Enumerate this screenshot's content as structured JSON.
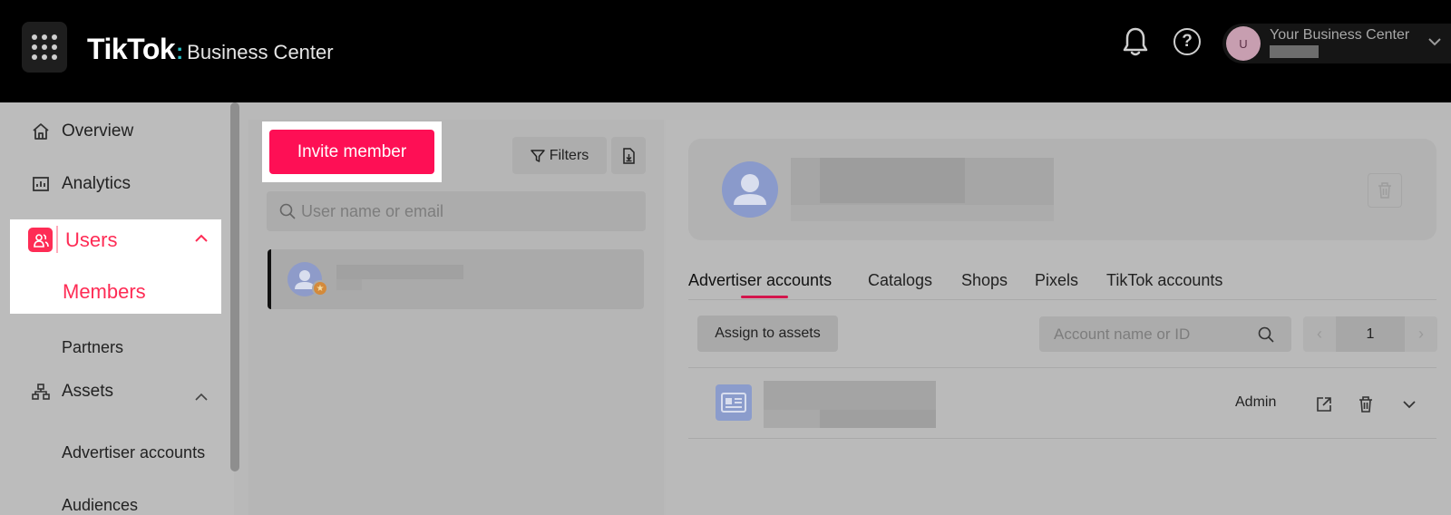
{
  "header": {
    "logo_main": "TikTok",
    "logo_colon": ":",
    "logo_sub": "Business Center",
    "account_name": "Your Business Center",
    "account_initial": "U"
  },
  "sidebar": {
    "items": [
      {
        "label": "Overview",
        "icon": "home-icon"
      },
      {
        "label": "Analytics",
        "icon": "analytics-icon"
      },
      {
        "label": "Users",
        "icon": "users-icon"
      },
      {
        "label": "Members"
      },
      {
        "label": "Partners"
      },
      {
        "label": "Assets",
        "icon": "assets-icon"
      },
      {
        "label": "Advertiser accounts"
      },
      {
        "label": "Audiences"
      }
    ]
  },
  "members_panel": {
    "invite_label": "Invite member",
    "filters_label": "Filters",
    "search_placeholder": "User name or email"
  },
  "detail_panel": {
    "tabs": [
      "Advertiser accounts",
      "Catalogs",
      "Shops",
      "Pixels",
      "TikTok accounts"
    ],
    "assign_label": "Assign to assets",
    "account_search_placeholder": "Account name or ID",
    "page_number": "1",
    "row_role": "Admin"
  },
  "colors": {
    "brand": "#fe2c55",
    "topbar": "#000000",
    "logo_accent": "#25c2c9"
  }
}
